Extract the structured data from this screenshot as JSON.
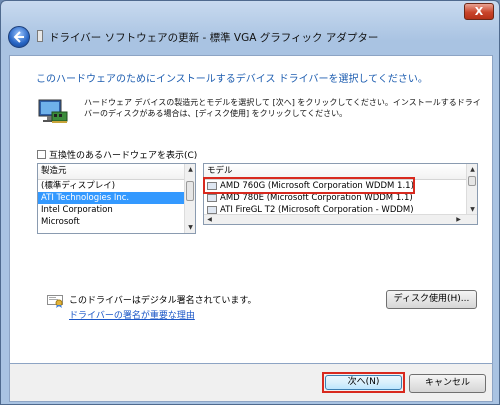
{
  "window": {
    "title": "ドライバー ソフトウェアの更新 - 標準 VGA グラフィック アダプター",
    "close_label": "X"
  },
  "heading": "このハードウェアのためにインストールするデバイス ドライバーを選択してください。",
  "instruction": "ハードウェア デバイスの製造元とモデルを選択して [次へ] をクリックしてください。インストールするドライバーのディスクがある場合は、[ディスク使用] をクリックしてください。",
  "compatible_checkbox": {
    "label": "互換性のあるハードウェアを表示(C)",
    "checked": false
  },
  "manufacturer_list": {
    "header": "製造元",
    "items": [
      "(標準ディスプレイ)",
      "ATI Technologies Inc.",
      "Intel Corporation",
      "Microsoft"
    ],
    "selected_index": 1
  },
  "model_list": {
    "header": "モデル",
    "items": [
      "AMD 760G (Microsoft Corporation WDDM 1.1)",
      "AMD 780E (Microsoft Corporation WDDM 1.1)",
      "ATI FireGL T2 (Microsoft Corporation - WDDM)"
    ]
  },
  "signature": {
    "text": "このドライバーはデジタル署名されています。",
    "link": "ドライバーの署名が重要な理由"
  },
  "buttons": {
    "disk": "ディスク使用(H)...",
    "next": "次へ(N)",
    "cancel": "キャンセル"
  },
  "colors": {
    "highlight_border": "#d8291e",
    "selection": "#3399ff",
    "heading": "#1d5db0",
    "link": "#1a56c7"
  }
}
